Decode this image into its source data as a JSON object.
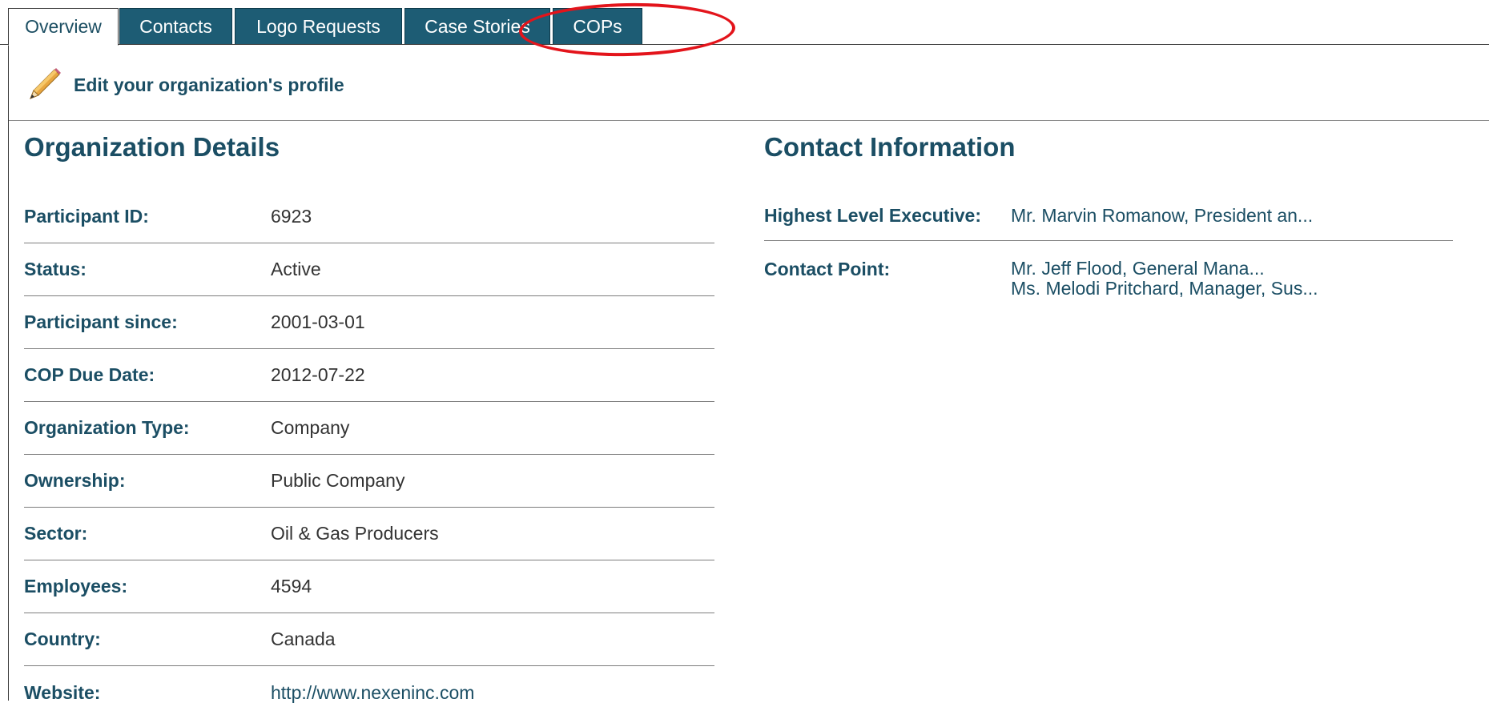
{
  "tabs": [
    {
      "label": "Overview",
      "active": true
    },
    {
      "label": "Contacts",
      "active": false
    },
    {
      "label": "Logo Requests",
      "active": false
    },
    {
      "label": "Case Stories",
      "active": false
    },
    {
      "label": "COPs",
      "active": false
    }
  ],
  "edit_profile": {
    "label": "Edit your organization's profile",
    "icon": "pencil-icon"
  },
  "organization": {
    "title": "Organization Details",
    "fields": [
      {
        "label": "Participant ID:",
        "value": "6923"
      },
      {
        "label": "Status:",
        "value": "Active"
      },
      {
        "label": "Participant since:",
        "value": "2001-03-01"
      },
      {
        "label": "COP Due Date:",
        "value": "2012-07-22"
      },
      {
        "label": "Organization Type:",
        "value": "Company"
      },
      {
        "label": "Ownership:",
        "value": "Public Company"
      },
      {
        "label": "Sector:",
        "value": "Oil & Gas Producers"
      },
      {
        "label": "Employees:",
        "value": "4594"
      },
      {
        "label": "Country:",
        "value": "Canada"
      },
      {
        "label": "Website:",
        "value": "http://www.nexeninc.com"
      }
    ]
  },
  "contact": {
    "title": "Contact Information",
    "highest_label": "Highest Level Executive:",
    "highest_value": "Mr. Marvin Romanow, President an...",
    "point_label": "Contact Point:",
    "point_values": [
      "Mr. Jeff Flood, General Mana...",
      "Ms. Melodi Pritchard, Manager, Sus..."
    ]
  },
  "colors": {
    "tab_bg": "#1d5c74",
    "heading": "#1b4e64",
    "annotation": "#e3141b"
  }
}
